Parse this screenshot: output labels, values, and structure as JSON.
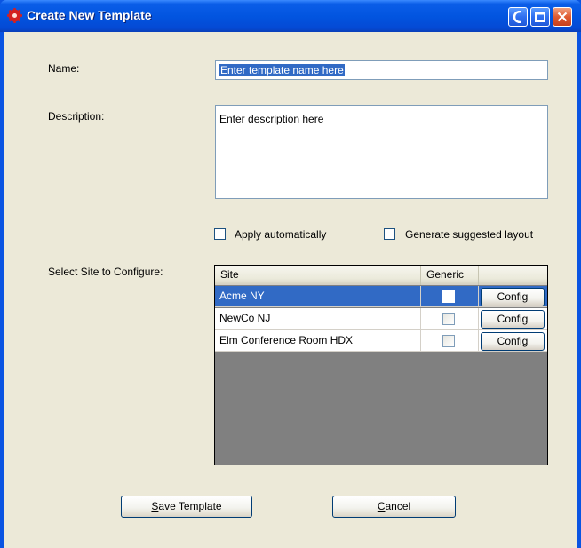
{
  "window": {
    "title": "Create New Template"
  },
  "form": {
    "name_label": "Name:",
    "name_value": "Enter template name here",
    "description_label": "Description:",
    "description_value": "Enter description here",
    "apply_automatically_label": "Apply automatically",
    "apply_automatically_checked": false,
    "generate_layout_label": "Generate suggested layout",
    "generate_layout_checked": false,
    "select_site_label": "Select Site to Configure:"
  },
  "grid": {
    "columns": [
      "Site",
      "Generic",
      ""
    ],
    "rows": [
      {
        "site": "Acme NY",
        "generic": false,
        "action": "Config",
        "selected": true
      },
      {
        "site": "NewCo NJ",
        "generic": false,
        "action": "Config",
        "selected": false
      },
      {
        "site": "Elm Conference Room HDX",
        "generic": false,
        "action": "Config",
        "selected": false
      }
    ]
  },
  "buttons": {
    "save_first": "S",
    "save_rest": "ave Template",
    "cancel_first": "C",
    "cancel_rest": "ancel"
  },
  "colors": {
    "titlebar": "#0255e0",
    "client_bg": "#ece9d8",
    "selection": "#316ac5",
    "grid_bg": "#808080"
  }
}
